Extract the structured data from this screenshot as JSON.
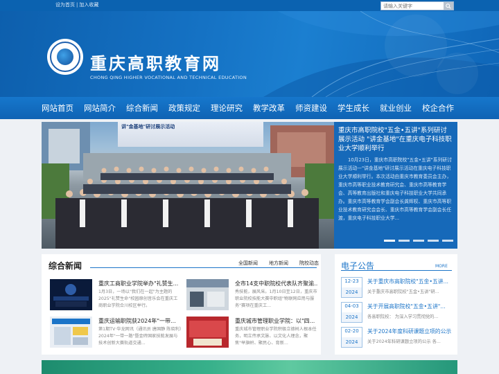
{
  "topbar": {
    "links": [
      "设为首页",
      "|",
      "加入收藏"
    ],
    "search_placeholder": "请输入关键字",
    "search_icon": "search-icon"
  },
  "banner": {
    "title": "重庆高职教育网",
    "subtitle": "CHONG QING HIGHER VOCATIONAL AND TECHNICAL EDUCATION"
  },
  "nav": {
    "items": [
      "网站首页",
      "网站简介",
      "综合新闻",
      "政策规定",
      "理论研究",
      "教学改革",
      "师资建设",
      "学生成长",
      "就业创业",
      "校企合作"
    ]
  },
  "slider": {
    "photo_banner": "讲\"金基地\"研讨展示活动",
    "title": "重庆市高职院校\"五金•五讲\"系列研讨展示活动 \"讲金基地\"在重庆电子科技职业大学顺利举行",
    "body": "10月23日，重庆市高职院校\"五金•五讲\"系列研讨展示活动—\"讲金基地\"研讨展示活动在重庆电子科技职业大学顺利举行。本次活动由重庆市教育委员会主办，重庆市高等职业技术教育研究会、重庆市高等教育学会、高等教育出版社和重庆电子科技职业大学共同承办。重庆市高等教育学会副会长龚辉权、重庆市高等职业技术教育研究会会长、重庆市高等教育学会副会长任渡，重庆电子科技职业大学...",
    "dot_count": 5
  },
  "news": {
    "heading": "综合新闻",
    "tabs": [
      "全国新闻",
      "地方新闻",
      "院校动态"
    ],
    "cards": [
      {
        "title": "重庆工商职业学院举办\"礼赞生...",
        "summary": "1月3日，一场以\"我们在一起\"为主题的2025\"礼赞生命\"校园原创音乐会在重庆工商职业学院合川校区举行。"
      },
      {
        "title": "全市14支中职院校代表队齐聚渝...",
        "summary": "秀技能，展风采。1月10日至12日，重庆市职业院校技能大赛中职组\"物联网应用与服务\"赛项在重庆工..."
      },
      {
        "title": "重庆运输职院获2024年\"一带...",
        "summary": "第1期TV·华龙网讯（通讯员 唐国静 陈晓利）2024年\"一带一路\"暨金砖国家技能发展与技术创新大赛轨道交通..."
      },
      {
        "title": "重庆城市管理职业学院：以\"四...",
        "summary": "重庆城市管理职业学院积极立德树人根本任务，明立传承文脉、以文化人理念，聚焦\"举旗帜、聚民心、育新..."
      }
    ]
  },
  "notice": {
    "heading": "电子公告",
    "more": "MORE",
    "items": [
      {
        "md": "12-23",
        "year": "2024",
        "title": "关于重庆市高职院校\"五金•五讲...",
        "excerpt": "关于重庆市高职院校\"五金•五讲\"研..."
      },
      {
        "md": "04-03",
        "year": "2024",
        "title": "关于开展高职院校\"五金•五讲\"...",
        "excerpt": "各高职院校：  为深入学习贯彻党的..."
      },
      {
        "md": "02-20",
        "year": "2024",
        "title": "关于2024年度科研课题立项的公示",
        "excerpt": "关于2024年科研课题立项的公示 各..."
      }
    ]
  },
  "colors": {
    "primary": "#1b74c8",
    "nav": "#1677cc",
    "slider_bg": "#1669b9"
  }
}
